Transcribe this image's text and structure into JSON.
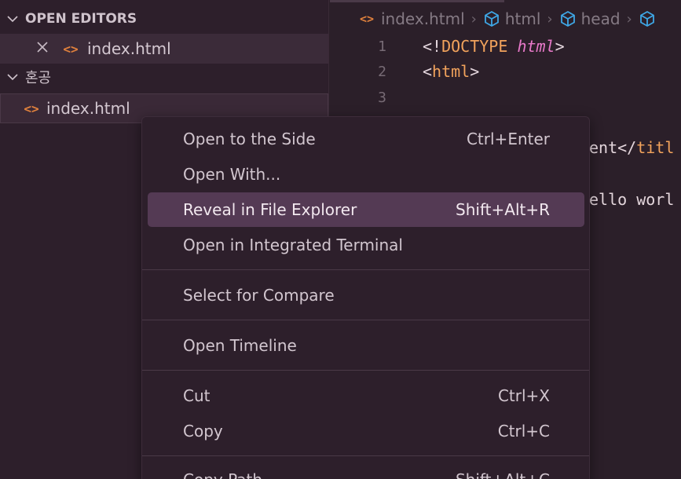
{
  "sidebar": {
    "open_editors_title": "OPEN EDITORS",
    "open_editor_file": "index.html",
    "folder_name": "혼공",
    "folder_file": "index.html"
  },
  "editor": {
    "breadcrumb": [
      "index.html",
      "html",
      "head"
    ],
    "lines": [
      {
        "num": "1",
        "parts": [
          "<!",
          "DOCTYPE",
          " ",
          "html",
          ">"
        ]
      },
      {
        "num": "2",
        "parts": [
          "<",
          "html",
          ">"
        ]
      },
      {
        "num": "3",
        "parts": []
      }
    ],
    "visible_fragment_1": "ent</",
    "visible_fragment_1_tag": "titl",
    "visible_fragment_2": "ello worl"
  },
  "context_menu": {
    "items": [
      {
        "label": "Open to the Side",
        "shortcut": "Ctrl+Enter"
      },
      {
        "label": "Open With...",
        "shortcut": ""
      },
      {
        "label": "Reveal in File Explorer",
        "shortcut": "Shift+Alt+R"
      },
      {
        "label": "Open in Integrated Terminal",
        "shortcut": ""
      },
      {
        "label": "Select for Compare",
        "shortcut": ""
      },
      {
        "label": "Open Timeline",
        "shortcut": ""
      },
      {
        "label": "Cut",
        "shortcut": "Ctrl+X"
      },
      {
        "label": "Copy",
        "shortcut": "Ctrl+C"
      },
      {
        "label": "Copy Path",
        "shortcut": "Shift+Alt+C"
      }
    ],
    "highlighted_index": 2
  },
  "colors": {
    "accent_orange": "#e0813d",
    "cube_blue": "#3ea7e6",
    "highlight_bg": "#543a54"
  },
  "icons": {
    "chevron": "chevron-down-icon",
    "close": "close-icon",
    "html_file": "html-file-icon",
    "symbol_cube": "symbol-cube-icon"
  }
}
